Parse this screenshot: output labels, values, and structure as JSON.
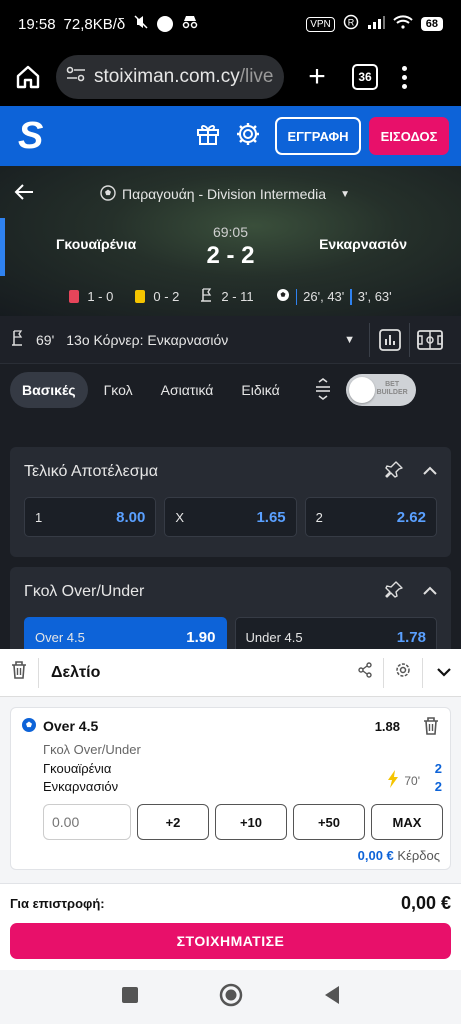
{
  "status": {
    "time": "19:58",
    "speed": "72,8KB/δ",
    "vpn": "VPN",
    "battery": "68"
  },
  "browser": {
    "url_main": "stoiximan.com.cy",
    "url_path": "/live",
    "tab_count": "36"
  },
  "header": {
    "logo": "S",
    "register_label": "ΕΓΓΡΑΦΗ",
    "login_label": "ΕΙΣΟΔΟΣ"
  },
  "match": {
    "league": "Παραγουάη - Division Intermedia",
    "time": "69:05",
    "score": "2 - 2",
    "home": "Γκουαϊρένια",
    "away": "Ενκαρνασιόν",
    "red_cards": "1 - 0",
    "yellow_cards": "0 - 2",
    "corners": "2 - 11",
    "goals_home": "26', 43'",
    "goals_away": "3', 63'"
  },
  "event": {
    "minute": "69'",
    "text": "13ο Κόρνερ: Ενκαρνασιόν"
  },
  "tabs": [
    {
      "label": "Βασικές"
    },
    {
      "label": "Γκολ"
    },
    {
      "label": "Ασιατικά"
    },
    {
      "label": "Ειδικά"
    }
  ],
  "bet_builder": {
    "line1": "BET",
    "line2": "BUILDER"
  },
  "markets": {
    "final": {
      "title": "Τελικό Αποτέλεσμα",
      "odds": [
        {
          "label": "1",
          "value": "8.00"
        },
        {
          "label": "Χ",
          "value": "1.65"
        },
        {
          "label": "2",
          "value": "2.62"
        }
      ]
    },
    "ou": {
      "title": "Γκολ Over/Under",
      "odds": [
        {
          "label": "Over 4.5",
          "value": "1.90"
        },
        {
          "label": "Under 4.5",
          "value": "1.78"
        }
      ]
    }
  },
  "slip": {
    "title": "Δελτίο",
    "selection": "Over 4.5",
    "odd": "1.88",
    "market": "Γκολ Over/Under",
    "home": "Γκουαϊρένια",
    "away": "Ενκαρνασιόν",
    "minute": "70'",
    "score_home": "2",
    "score_away": "2",
    "stake_placeholder": "0.00",
    "quick": [
      "+2",
      "+10",
      "+50",
      "MAX"
    ],
    "profit_value": "0,00 €",
    "profit_label": "Κέρδος",
    "return_label": "Για επιστροφή:",
    "return_value": "0,00 €",
    "place_label": "ΣΤΟΙΧΗΜΑΤΙΣΕ"
  },
  "colors": {
    "brand_blue": "#0d63d8",
    "accent_pink": "#e8106a",
    "odds_blue": "#5aa0ff"
  }
}
